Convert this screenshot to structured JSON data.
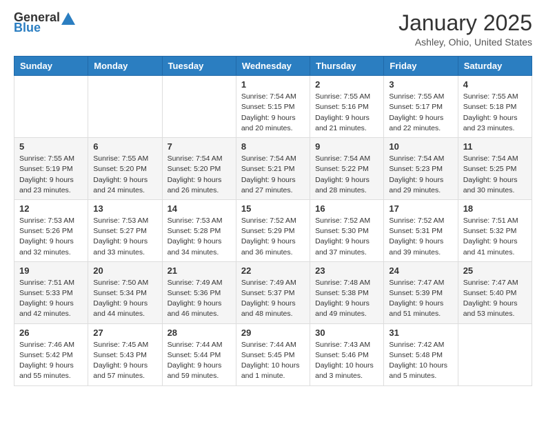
{
  "header": {
    "logo_general": "General",
    "logo_blue": "Blue",
    "month": "January 2025",
    "location": "Ashley, Ohio, United States"
  },
  "days_of_week": [
    "Sunday",
    "Monday",
    "Tuesday",
    "Wednesday",
    "Thursday",
    "Friday",
    "Saturday"
  ],
  "weeks": [
    [
      {
        "day": "",
        "info": ""
      },
      {
        "day": "",
        "info": ""
      },
      {
        "day": "",
        "info": ""
      },
      {
        "day": "1",
        "info": "Sunrise: 7:54 AM\nSunset: 5:15 PM\nDaylight: 9 hours\nand 20 minutes."
      },
      {
        "day": "2",
        "info": "Sunrise: 7:55 AM\nSunset: 5:16 PM\nDaylight: 9 hours\nand 21 minutes."
      },
      {
        "day": "3",
        "info": "Sunrise: 7:55 AM\nSunset: 5:17 PM\nDaylight: 9 hours\nand 22 minutes."
      },
      {
        "day": "4",
        "info": "Sunrise: 7:55 AM\nSunset: 5:18 PM\nDaylight: 9 hours\nand 23 minutes."
      }
    ],
    [
      {
        "day": "5",
        "info": "Sunrise: 7:55 AM\nSunset: 5:19 PM\nDaylight: 9 hours\nand 23 minutes."
      },
      {
        "day": "6",
        "info": "Sunrise: 7:55 AM\nSunset: 5:20 PM\nDaylight: 9 hours\nand 24 minutes."
      },
      {
        "day": "7",
        "info": "Sunrise: 7:54 AM\nSunset: 5:20 PM\nDaylight: 9 hours\nand 26 minutes."
      },
      {
        "day": "8",
        "info": "Sunrise: 7:54 AM\nSunset: 5:21 PM\nDaylight: 9 hours\nand 27 minutes."
      },
      {
        "day": "9",
        "info": "Sunrise: 7:54 AM\nSunset: 5:22 PM\nDaylight: 9 hours\nand 28 minutes."
      },
      {
        "day": "10",
        "info": "Sunrise: 7:54 AM\nSunset: 5:23 PM\nDaylight: 9 hours\nand 29 minutes."
      },
      {
        "day": "11",
        "info": "Sunrise: 7:54 AM\nSunset: 5:25 PM\nDaylight: 9 hours\nand 30 minutes."
      }
    ],
    [
      {
        "day": "12",
        "info": "Sunrise: 7:53 AM\nSunset: 5:26 PM\nDaylight: 9 hours\nand 32 minutes."
      },
      {
        "day": "13",
        "info": "Sunrise: 7:53 AM\nSunset: 5:27 PM\nDaylight: 9 hours\nand 33 minutes."
      },
      {
        "day": "14",
        "info": "Sunrise: 7:53 AM\nSunset: 5:28 PM\nDaylight: 9 hours\nand 34 minutes."
      },
      {
        "day": "15",
        "info": "Sunrise: 7:52 AM\nSunset: 5:29 PM\nDaylight: 9 hours\nand 36 minutes."
      },
      {
        "day": "16",
        "info": "Sunrise: 7:52 AM\nSunset: 5:30 PM\nDaylight: 9 hours\nand 37 minutes."
      },
      {
        "day": "17",
        "info": "Sunrise: 7:52 AM\nSunset: 5:31 PM\nDaylight: 9 hours\nand 39 minutes."
      },
      {
        "day": "18",
        "info": "Sunrise: 7:51 AM\nSunset: 5:32 PM\nDaylight: 9 hours\nand 41 minutes."
      }
    ],
    [
      {
        "day": "19",
        "info": "Sunrise: 7:51 AM\nSunset: 5:33 PM\nDaylight: 9 hours\nand 42 minutes."
      },
      {
        "day": "20",
        "info": "Sunrise: 7:50 AM\nSunset: 5:34 PM\nDaylight: 9 hours\nand 44 minutes."
      },
      {
        "day": "21",
        "info": "Sunrise: 7:49 AM\nSunset: 5:36 PM\nDaylight: 9 hours\nand 46 minutes."
      },
      {
        "day": "22",
        "info": "Sunrise: 7:49 AM\nSunset: 5:37 PM\nDaylight: 9 hours\nand 48 minutes."
      },
      {
        "day": "23",
        "info": "Sunrise: 7:48 AM\nSunset: 5:38 PM\nDaylight: 9 hours\nand 49 minutes."
      },
      {
        "day": "24",
        "info": "Sunrise: 7:47 AM\nSunset: 5:39 PM\nDaylight: 9 hours\nand 51 minutes."
      },
      {
        "day": "25",
        "info": "Sunrise: 7:47 AM\nSunset: 5:40 PM\nDaylight: 9 hours\nand 53 minutes."
      }
    ],
    [
      {
        "day": "26",
        "info": "Sunrise: 7:46 AM\nSunset: 5:42 PM\nDaylight: 9 hours\nand 55 minutes."
      },
      {
        "day": "27",
        "info": "Sunrise: 7:45 AM\nSunset: 5:43 PM\nDaylight: 9 hours\nand 57 minutes."
      },
      {
        "day": "28",
        "info": "Sunrise: 7:44 AM\nSunset: 5:44 PM\nDaylight: 9 hours\nand 59 minutes."
      },
      {
        "day": "29",
        "info": "Sunrise: 7:44 AM\nSunset: 5:45 PM\nDaylight: 10 hours\nand 1 minute."
      },
      {
        "day": "30",
        "info": "Sunrise: 7:43 AM\nSunset: 5:46 PM\nDaylight: 10 hours\nand 3 minutes."
      },
      {
        "day": "31",
        "info": "Sunrise: 7:42 AM\nSunset: 5:48 PM\nDaylight: 10 hours\nand 5 minutes."
      },
      {
        "day": "",
        "info": ""
      }
    ]
  ]
}
